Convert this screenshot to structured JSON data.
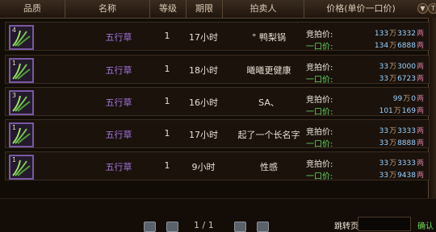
{
  "header": {
    "quality": "品质",
    "name": "名称",
    "level": "等级",
    "duration": "期限",
    "seller": "拍卖人",
    "price": "价格(单价一口价)",
    "sort_icon_1": "sort-icon",
    "sort_icon_2": "sort-icon"
  },
  "rows": [
    {
      "item_count": "4",
      "name": "五行草",
      "level": "1",
      "time": "17小时",
      "seller": "°  鸭梨锅",
      "bid_label": "竞拍价:",
      "buyout_label": "一口价:",
      "bid_price": {
        "wan": "133",
        "liang": "3332"
      },
      "buyout_price": {
        "wan": "134",
        "liang": "6888"
      }
    },
    {
      "item_count": "1",
      "name": "五行草",
      "level": "1",
      "time": "18小时",
      "seller": "曦曦更健康",
      "bid_label": "竞拍价:",
      "buyout_label": "一口价:",
      "bid_price": {
        "wan": "33",
        "liang": "3000"
      },
      "buyout_price": {
        "wan": "33",
        "liang": "6723"
      }
    },
    {
      "item_count": "3",
      "name": "五行草",
      "level": "1",
      "time": "16小时",
      "seller": "SA、",
      "bid_label": "竞拍价:",
      "buyout_label": "一口价:",
      "bid_price": {
        "wan": "99",
        "liang": "0"
      },
      "buyout_price": {
        "wan": "101",
        "liang": "169"
      }
    },
    {
      "item_count": "1",
      "name": "五行草",
      "level": "1",
      "time": "17小时",
      "seller": "起了一个长名字",
      "bid_label": "竞拍价:",
      "buyout_label": "一口价:",
      "bid_price": {
        "wan": "33",
        "liang": "3333"
      },
      "buyout_price": {
        "wan": "33",
        "liang": "8888"
      }
    },
    {
      "item_count": "1",
      "name": "五行草",
      "level": "1",
      "time": "9小时",
      "seller": "性感",
      "bid_label": "竞拍价:",
      "buyout_label": "一口价:",
      "bid_price": {
        "wan": "33",
        "liang": "3333"
      },
      "buyout_price": {
        "wan": "33",
        "liang": "9438"
      }
    }
  ],
  "currency": {
    "wan": "万",
    "liang": "两"
  },
  "footer": {
    "page": "1 / 1",
    "jump_label": "跳转页",
    "confirm": "确认"
  },
  "colors": {
    "item_name": "#a575df",
    "buyout_label": "#64d860",
    "price_value": "#9ad2ff"
  }
}
